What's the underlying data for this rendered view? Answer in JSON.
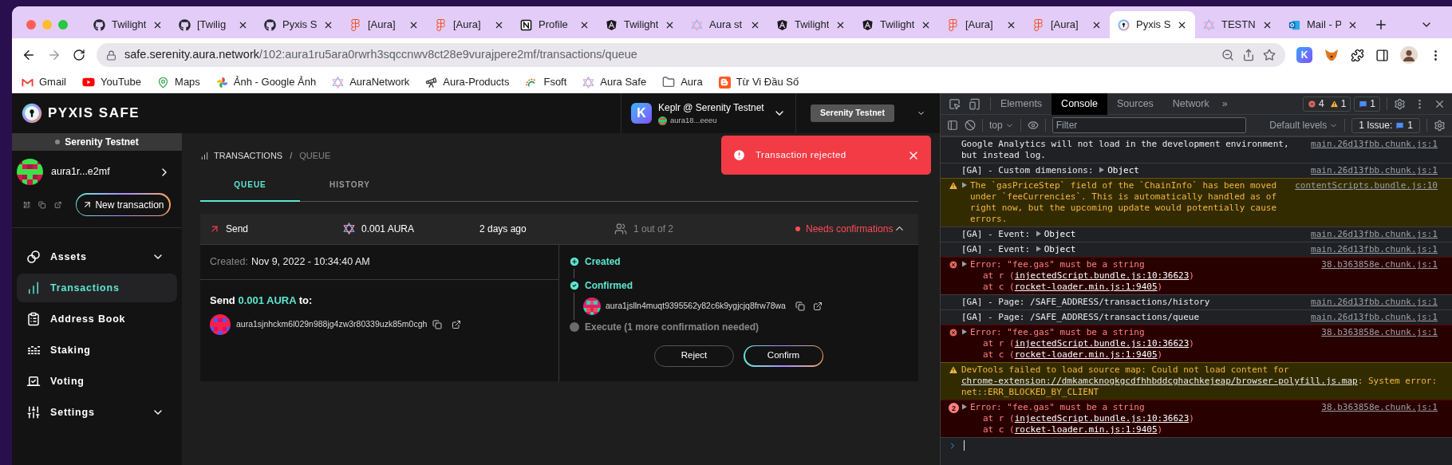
{
  "browser": {
    "tabs": [
      {
        "title": "Twilight",
        "kind": "github",
        "selected": false
      },
      {
        "title": "[Twilig",
        "kind": "github",
        "selected": false
      },
      {
        "title": "Pyxis S",
        "kind": "github",
        "selected": false
      },
      {
        "title": "[Aura]",
        "kind": "figma",
        "selected": false
      },
      {
        "title": "[Aura]",
        "kind": "figma",
        "selected": false
      },
      {
        "title": "Profile",
        "kind": "notion",
        "selected": false
      },
      {
        "title": "Twilight",
        "kind": "angular",
        "selected": false
      },
      {
        "title": "Aura st",
        "kind": "aura",
        "selected": false
      },
      {
        "title": "Twilight",
        "kind": "angular",
        "selected": false
      },
      {
        "title": "Twilight",
        "kind": "angular",
        "selected": false
      },
      {
        "title": "[Aura]",
        "kind": "figma",
        "selected": false
      },
      {
        "title": "[Aura]",
        "kind": "figma",
        "selected": false
      },
      {
        "title": "Pyxis S",
        "kind": "pyxis",
        "selected": true
      },
      {
        "title": "TESTN",
        "kind": "aura",
        "selected": false
      },
      {
        "title": "Mail - P",
        "kind": "outlook",
        "selected": false
      }
    ],
    "address": {
      "host": "safe.serenity.aura.network",
      "path": "/102:aura1ru5ara0rwrh3sqccnwv8ct28e9vurajpere2mf/transactions/queue"
    },
    "extension_badge": "K",
    "bookmarks": [
      {
        "label": "Gmail",
        "kind": "gmail"
      },
      {
        "label": "YouTube",
        "kind": "youtube"
      },
      {
        "label": "Maps",
        "kind": "maps"
      },
      {
        "label": "Ảnh - Google Ảnh",
        "kind": "photos"
      },
      {
        "label": "AuraNetwork",
        "kind": "aura"
      },
      {
        "label": "Aura-Products",
        "kind": "telescope"
      },
      {
        "label": "Fsoft",
        "kind": "fsoft"
      },
      {
        "label": "Aura Safe",
        "kind": "aura"
      },
      {
        "label": "Aura",
        "kind": "folder"
      },
      {
        "label": "Từ Vi Đầu Số",
        "kind": "blogger"
      }
    ]
  },
  "app": {
    "logo": "PYXIS SAFE",
    "wallet": {
      "badge": "K",
      "name": "Keplr @ Serenity Testnet",
      "address": "aura18...eeeu"
    },
    "network": "Serenity Testnet",
    "sidebar": {
      "network": "Serenity Testnet",
      "account": "aura1r...e2mf",
      "new_transaction": "New transaction",
      "items": [
        {
          "label": "Assets",
          "kind": "assets",
          "expandable": true,
          "selected": false
        },
        {
          "label": "Transactions",
          "kind": "transactions",
          "expandable": false,
          "selected": true
        },
        {
          "label": "Address Book",
          "kind": "address-book",
          "expandable": false,
          "selected": false
        },
        {
          "label": "Staking",
          "kind": "staking",
          "expandable": false,
          "selected": false
        },
        {
          "label": "Voting",
          "kind": "voting",
          "expandable": false,
          "selected": false
        },
        {
          "label": "Settings",
          "kind": "settings",
          "expandable": true,
          "selected": false
        }
      ]
    },
    "breadcrumb": {
      "section": "TRANSACTIONS",
      "separator": "/",
      "page": "QUEUE"
    },
    "tabs": [
      {
        "label": "QUEUE",
        "selected": true
      },
      {
        "label": "HISTORY",
        "selected": false
      }
    ],
    "transaction": {
      "type": "Send",
      "amount": "0.001 AURA",
      "time": "2 days ago",
      "confirmations": "1 out of 2",
      "status": "Needs confirmations",
      "expanded": true,
      "created_label": "Created:",
      "created": "Nov 9, 2022 - 10:34:40 AM",
      "send_prefix": "Send",
      "send_amount": "0.001 AURA",
      "send_suffix": "to:",
      "recipient": "aura1sjnhckm6l029n988jg4zw3r80339uzk85m0cgh",
      "timeline": [
        {
          "label": "Created",
          "kind": "created"
        },
        {
          "label": "Confirmed",
          "kind": "confirmed",
          "owners": [
            "aura1jslln4muqt9395562y82c6k9ygjcjq8frw78wa"
          ]
        },
        {
          "label": "Execute (1 more confirmation needed)",
          "kind": "pending"
        }
      ],
      "actions": [
        {
          "label": "Reject",
          "kind": "reject"
        },
        {
          "label": "Confirm",
          "kind": "confirm"
        }
      ]
    },
    "toast": {
      "message": "Transaction rejected"
    }
  },
  "devtools": {
    "tabs": [
      {
        "label": "Elements",
        "selected": false
      },
      {
        "label": "Console",
        "selected": true
      },
      {
        "label": "Sources",
        "selected": false
      },
      {
        "label": "Network",
        "selected": false
      }
    ],
    "more": "»",
    "errors": "4",
    "warnings": "1",
    "infos": "1",
    "context": "top",
    "filter_placeholder": "Filter",
    "levels": "Default levels",
    "issues_label": "1 Issue:",
    "issues": "1",
    "console": [
      {
        "kind": "log",
        "text": "Google Analytics will not load in the development environment, but instead log.",
        "source": "main.26d13fbb.chunk.js:1"
      },
      {
        "kind": "log",
        "text": "[GA] - Custom dimensions: ",
        "object": "Object",
        "source": "main.26d13fbb.chunk.js:1"
      },
      {
        "kind": "warning",
        "expandable": true,
        "text": "The `gasPriceStep` field of the `ChainInfo` has been moved under `feeCurrencies`. This is automatically handled as of right now, but the upcoming update would potentially cause errors.",
        "source": "contentScripts.bundle.js:10"
      },
      {
        "kind": "log",
        "text": "[GA] - Event: ",
        "object": "Object",
        "source": "main.26d13fbb.chunk.js:1"
      },
      {
        "kind": "log",
        "text": "[GA] - Event: ",
        "object": "Object",
        "source": "main.26d13fbb.chunk.js:1"
      },
      {
        "kind": "error",
        "expandable": true,
        "text": "Error: \"fee.gas\" must be a string",
        "source": "38.b363858e.chunk.js:1",
        "stack": [
          {
            "prefix": "at r (",
            "link": "injectedScript.bundle.js:10:36623",
            "suffix": ")"
          },
          {
            "prefix": "at c (",
            "link": "rocket-loader.min.js:1:9405",
            "suffix": ")"
          }
        ]
      },
      {
        "kind": "log",
        "text": "[GA] - Page: /SAFE_ADDRESS/transactions/history",
        "source": "main.26d13fbb.chunk.js:1"
      },
      {
        "kind": "log",
        "text": "[GA] - Page: /SAFE_ADDRESS/transactions/queue",
        "source": "main.26d13fbb.chunk.js:1"
      },
      {
        "kind": "error",
        "expandable": true,
        "text": "Error: \"fee.gas\" must be a string",
        "source": "38.b363858e.chunk.js:1",
        "stack": [
          {
            "prefix": "at r (",
            "link": "injectedScript.bundle.js:10:36623",
            "suffix": ")"
          },
          {
            "prefix": "at c (",
            "link": "rocket-loader.min.js:1:9405",
            "suffix": ")"
          }
        ]
      },
      {
        "kind": "warning",
        "text": "DevTools failed to load source map: Could not load content for ",
        "link": "chrome-extension://dmkamcknogkgcdfhhbddcghachkejeap/browser-polyfill.js.map",
        "text_after": ": System error: net::ERR_BLOCKED_BY_CLIENT"
      },
      {
        "kind": "error",
        "count": "2",
        "expandable": true,
        "text": "Error: \"fee.gas\" must be a string",
        "source": "38.b363858e.chunk.js:1",
        "stack": [
          {
            "prefix": "at r (",
            "link": "injectedScript.bundle.js:10:36623",
            "suffix": ")"
          },
          {
            "prefix": "at c (",
            "link": "rocket-loader.min.js:1:9405",
            "suffix": ")"
          }
        ]
      }
    ]
  }
}
